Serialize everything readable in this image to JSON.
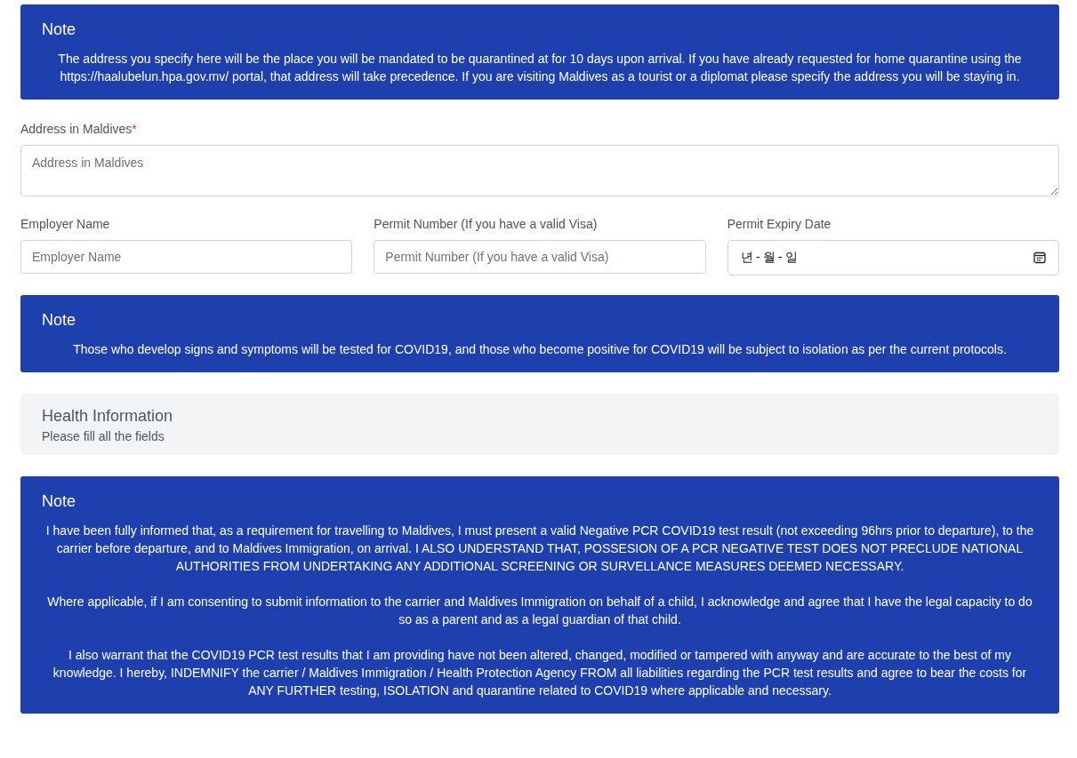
{
  "sections": [
    {
      "kind": "note",
      "title": "Note",
      "paragraphs": [
        "The address you specify here will be the place you will be mandated to be quarantined at for 10 days upon arrival. If you have already requested for home quarantine using the https://haalubelun.hpa.gov.mv/ portal, that address will take precedence. If you are visiting Maldives as a tourist or a diplomat please specify the address you will be staying in."
      ]
    },
    {
      "kind": "fields",
      "fields": [
        {
          "kind": "textarea",
          "label": "Address in Maldives",
          "required_mark": "*",
          "placeholder": "Address in Maldives"
        }
      ]
    },
    {
      "kind": "fields",
      "fields": [
        {
          "kind": "text",
          "label": "Employer Name",
          "placeholder": "Employer Name"
        },
        {
          "kind": "text",
          "label": "Permit Number (If you have a valid Visa)",
          "placeholder": "Permit Number (If you have a valid Visa)"
        },
        {
          "kind": "date",
          "label": "Permit Expiry Date",
          "placeholder": "년-월-일"
        }
      ]
    },
    {
      "kind": "note",
      "title": "Note",
      "paragraphs": [
        "Those who develop signs and symptoms will be tested for COVID19, and those who become positive for COVID19 will be subject to isolation as per the current protocols."
      ]
    },
    {
      "kind": "header",
      "title": "Health Information",
      "subtitle": "Please fill all the fields"
    },
    {
      "kind": "note",
      "title": "Note",
      "paragraphs": [
        "I have been fully informed that, as a requirement for travelling to Maldives, I must present a valid Negative PCR COVID19 test result (not exceeding 96hrs prior to departure), to the carrier before departure, and to Maldives Immigration, on arrival. I ALSO UNDERSTAND THAT, POSSESION OF A PCR NEGATIVE TEST DOES NOT PRECLUDE NATIONAL AUTHORITIES FROM UNDERTAKING ANY ADDITIONAL SCREENING OR SURVELLANCE MEASURES DEEMED NECESSARY.",
        "Where applicable, if I am consenting to submit information to the carrier and Maldives Immigration on behalf of a child, I acknowledge and agree that I have the legal capacity to do so as a parent and as a legal guardian of that child.",
        "I also warrant that the COVID19 PCR test results that I am providing have not been altered, changed, modified or tampered with anyway and are accurate to the best of my knowledge. I hereby, INDEMNIFY the carrier / Maldives Immigration / Health Protection Agency FROM all liabilities regarding the PCR test results and agree to bear the costs for ANY FURTHER testing, ISOLATION and quarantine related to COVID19 where applicable and necessary."
      ]
    }
  ]
}
